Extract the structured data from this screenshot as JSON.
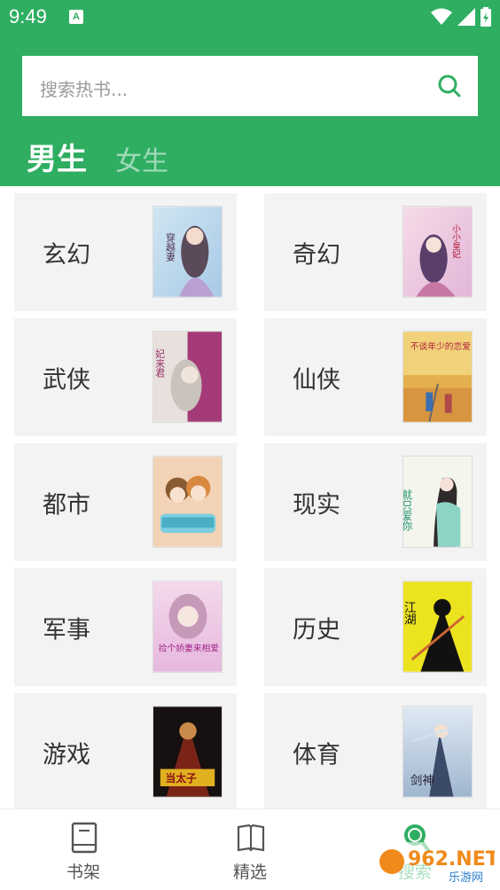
{
  "status_bar": {
    "time": "9:49",
    "notif_letter": "A"
  },
  "search": {
    "placeholder": "搜索热书..."
  },
  "tabs": [
    {
      "label": "男生",
      "active": true
    },
    {
      "label": "女生",
      "active": false
    }
  ],
  "categories": [
    {
      "label": "玄幻",
      "cover": "cover-xuanhuan"
    },
    {
      "label": "奇幻",
      "cover": "cover-qihuan"
    },
    {
      "label": "武侠",
      "cover": "cover-wuxia"
    },
    {
      "label": "仙侠",
      "cover": "cover-xianxia"
    },
    {
      "label": "都市",
      "cover": "cover-dushi"
    },
    {
      "label": "现实",
      "cover": "cover-xianshi"
    },
    {
      "label": "军事",
      "cover": "cover-junshi"
    },
    {
      "label": "历史",
      "cover": "cover-lishi"
    },
    {
      "label": "游戏",
      "cover": "cover-youxi"
    },
    {
      "label": "体育",
      "cover": "cover-tiyu"
    }
  ],
  "cover_titles": {
    "c0": "穿越妻",
    "c1": "小小皇妃",
    "c2": "妃来君",
    "c3": "不谈年少的恋爱",
    "c4": "",
    "c5": "就只爱你",
    "c6": "捡个娇妻来相爱",
    "c7": "江湖",
    "c8": "当太子",
    "c9": "剑神"
  },
  "bottom_nav": [
    {
      "label": "书架",
      "icon": "book-icon"
    },
    {
      "label": "精选",
      "icon": "open-book-icon"
    },
    {
      "label": "搜索",
      "icon": "search-icon",
      "active": true
    }
  ],
  "watermark": {
    "text": "962.NET",
    "sub": "乐游网"
  },
  "colors": {
    "accent": "#2fae62",
    "card_bg": "#f3f3f3"
  }
}
